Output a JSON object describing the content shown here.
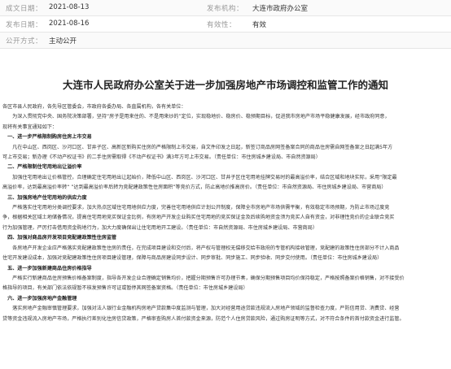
{
  "meta": {
    "row1": {
      "label_a": "成文日期：",
      "value_a": "2021-08-13",
      "label_b": "发布机构：",
      "value_b": "大连市政府办公室"
    },
    "row2": {
      "label_a": "发布日期：",
      "value_a": "2021-08-16",
      "label_b": "有效性：",
      "value_b": "有效"
    },
    "row3": {
      "label_a": "公开方式：",
      "value_a": "主动公开"
    }
  },
  "document": {
    "title": "大连市人民政府办公室关于进一步加强房地产市场调控和监管工作的通知",
    "lines": [
      {
        "type": "p",
        "text": "各区市县人民政府，各先导区管委会，市政府各委办局、各直属机构，各有关单位："
      },
      {
        "type": "p",
        "text": "　　为深入贯彻党中央、国务院决策部署，坚持“房子是用来住的、不是用来炒的”定位，实现稳地价、稳房价、稳预期目标，促进我市房地产市场平稳健康发展，经市政府同意，"
      },
      {
        "type": "p",
        "text": "现将有关事宜通知如下："
      },
      {
        "type": "h",
        "text": "　一、进一步严格限制购房住房上市交易"
      },
      {
        "type": "p",
        "text": "　　凡在中山区、西岗区、沙河口区、甘井子区、高新区新购买住房的严格限制上市交易，自文件印发之日起，新签订商品房网签备案合同的商品住房需自网签备案之日起满5年方"
      },
      {
        "type": "p",
        "text": "可上市交易；新办理《不动产权证书》的二手住房需取得《不动产权证书》满3年方可上市交易。（责任单位：市住房城乡建设局、市自然资源局）"
      },
      {
        "type": "h",
        "text": "　二、严格限制住宅用地出让溢价率"
      },
      {
        "type": "p",
        "text": "　　加强住宅用地出让价格管控，合理确定住宅用地出让起始价，降低中山区、西岗区、沙河口区、甘井子区住宅用地挂牌交易时的最高溢价率，结合区域和地块实际，采用“限定最"
      },
      {
        "type": "p",
        "text": "高溢价率，达到最高溢价率转“ ”达到最高溢价率后转为竞配建政策性住房面积”等竞价方式，防止高地价推高房价。（责任单位：市自然资源局、市住房城乡建设局、市营商局）"
      },
      {
        "type": "h",
        "text": "　三、加强房地产住宅用地的供应力度"
      },
      {
        "type": "p",
        "text": "　　严格落实住宅用地分类调控要求，加大热点区域住宅用地供应力度，完善住宅用地供应计划公开制度，保障全市房地产市场供需平衡，有效稳定市场预期，为防止市场过度竞"
      },
      {
        "type": "p",
        "text": "争，根据相关区域土地储备情况，提高住宅用地竞买保证金比例，有房地产开发企业购买住宅用地的竞买保证金及后续购地资金须为竞买人自有资金，对非理性竞价的企业联合竞买"
      },
      {
        "type": "p",
        "text": "行为加强管理，严厉打击借用资金购地行为，加大力度确保出让住宅用地开工建设。（责任单位：市自然资源局、市住房城乡建设局、市营商局）"
      },
      {
        "type": "h",
        "text": "　四、加强对商品房开发项目竞配建政策性住房监管"
      },
      {
        "type": "p",
        "text": "　　各房地产开发企业应严格落实竞配建政策性住房的责任，在完成项目建设和交付后，将产权与管理权无偿移交给市政府的专管机构接收管理，竞配建的政策性住房部分不计入商品"
      },
      {
        "type": "p",
        "text": "住宅开发建设成本，加强对竞配建政策性住房项目建设管理，保障与商品房建设同步设计、同步审批、同步施工、同步验收、同步交付使用。（责任单位：市住房城乡建设局）"
      },
      {
        "type": "h",
        "text": "　五、进一步加强新建商品住房价格指导"
      },
      {
        "type": "p",
        "text": "　　严格实行新建商品住房预售价格备案制度，指导各开发企业合理确定销售均价，把握分期预售许可办理节奏，确保分期预售项目均价保持稳定，严格按照备案价格销售，对不接受价"
      },
      {
        "type": "p",
        "text": "格指导的项目，有关部门依法依规暂不核发预售许可证或暂停其网签备案资格。（责任单位：市住房城乡建设局）"
      },
      {
        "type": "h",
        "text": "　六、进一步加强房地产金融管理"
      },
      {
        "type": "p",
        "text": "　　落实房地产金融审慎管理要求，加强对法人银行业金融机构房地产贷款集中度监测与管理，加大对经营用途贷款违规流入房地产领域的监督检查力度，严防信用贷、消费贷、经营"
      },
      {
        "type": "p",
        "text": "贷等资金违规流入房地产市场，严格执行差别化住房信贷政策，严格审查购房人首付款资金来源，防范个人住房贷款风险，通过购房证明等方式，对不符合条件的首付款资金进行监管。"
      }
    ]
  }
}
